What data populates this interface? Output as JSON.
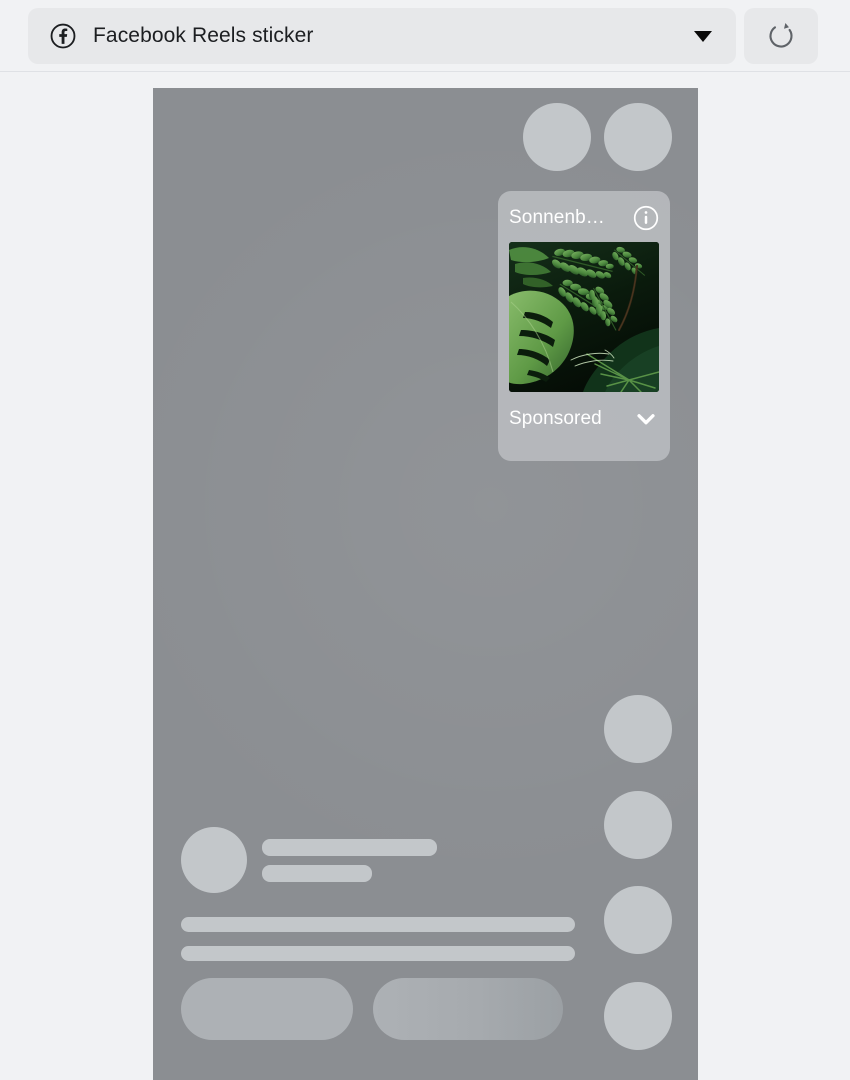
{
  "toolbar": {
    "selector": {
      "icon": "facebook-icon",
      "label": "Facebook Reels sticker",
      "caret_icon": "chevron-down-icon"
    },
    "refresh": {
      "icon": "refresh-icon",
      "label": "Refresh"
    }
  },
  "preview": {
    "background_color": "#8b8e92",
    "skeleton_color": "#c3c7ca",
    "pill_color": "#adb1b5",
    "top_circles": [
      {
        "name": "top-circle-1"
      },
      {
        "name": "top-circle-2"
      }
    ],
    "rail_circles": [
      {
        "name": "rail-circle-1"
      },
      {
        "name": "rail-circle-2"
      },
      {
        "name": "rail-circle-3"
      },
      {
        "name": "rail-circle-4"
      }
    ],
    "profile": {
      "avatar": "avatar-placeholder",
      "name_bar": "name-placeholder",
      "handle_bar": "handle-placeholder"
    },
    "caption_lines": 2,
    "cta_pills": 2
  },
  "sticker": {
    "title": "Sonnenb…",
    "info_icon": "info-icon",
    "media": {
      "alt": "tropical-foliage-photo",
      "description": "Dark tropical foliage with monstera leaf and fern fronds",
      "colors": {
        "background": "#0a1a0c",
        "leaf_light": "#7fb668",
        "leaf_mid": "#4f8a3f",
        "leaf_dark": "#2a5526",
        "stem": "#3a2a18"
      }
    },
    "cta_label": "Sponsored",
    "chevron_icon": "chevron-down-icon",
    "background_color": "rgba(190,193,196,.80)",
    "text_color": "#ffffff"
  }
}
